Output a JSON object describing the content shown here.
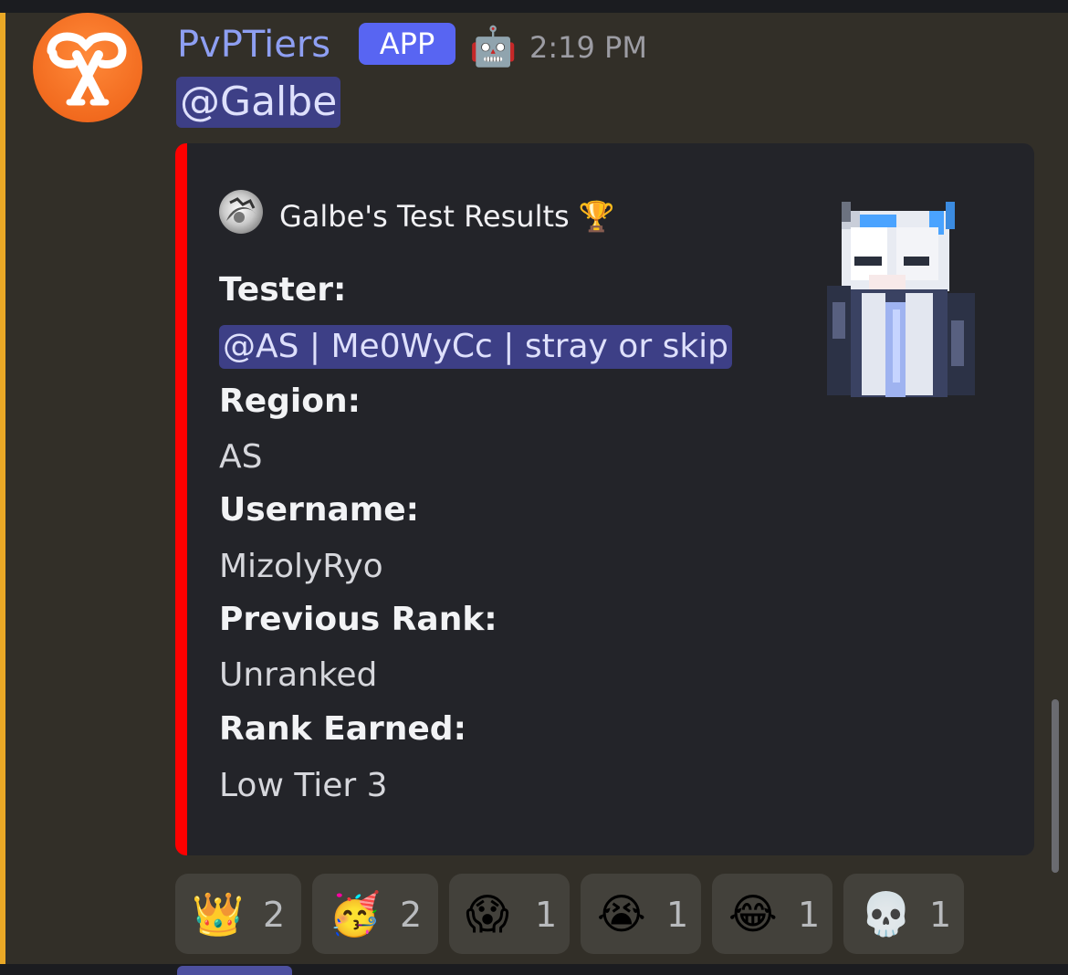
{
  "message": {
    "author": "PvPTiers",
    "badge": "APP",
    "bot_emoji": "🤖",
    "timestamp": "2:19 PM",
    "mention": "@Galbe"
  },
  "embed": {
    "accent_color": "#ff0000",
    "author_text": "Galbe's Test Results 🏆",
    "fields": [
      {
        "name": "Tester:",
        "value": "@AS | Me0WyCc | stray or skip",
        "is_mention": true
      },
      {
        "name": "Region:",
        "value": "AS"
      },
      {
        "name": "Username:",
        "value": "MizolyRyo"
      },
      {
        "name": "Previous Rank:",
        "value": "Unranked"
      },
      {
        "name": "Rank Earned:",
        "value": "Low Tier 3"
      }
    ]
  },
  "reactions": [
    {
      "emoji": "👑",
      "icon": "crown-icon",
      "count": "2"
    },
    {
      "emoji": "🥳",
      "icon": "partying-face-icon",
      "count": "2"
    },
    {
      "emoji": "😱",
      "icon": "screaming-face-icon",
      "count": "1"
    },
    {
      "emoji": "😭",
      "icon": "crying-face-icon",
      "count": "1"
    },
    {
      "emoji": "😂",
      "icon": "tears-of-joy-icon",
      "count": "1"
    },
    {
      "emoji": "💀",
      "icon": "skull-icon",
      "count": "1"
    }
  ],
  "colors": {
    "background": "#322f28",
    "embed_bg": "#232429",
    "mention_bg": "#3d3f86",
    "app_badge": "#5865f2",
    "username": "#8e9ff2",
    "highlight_bar": "#e9a826"
  }
}
